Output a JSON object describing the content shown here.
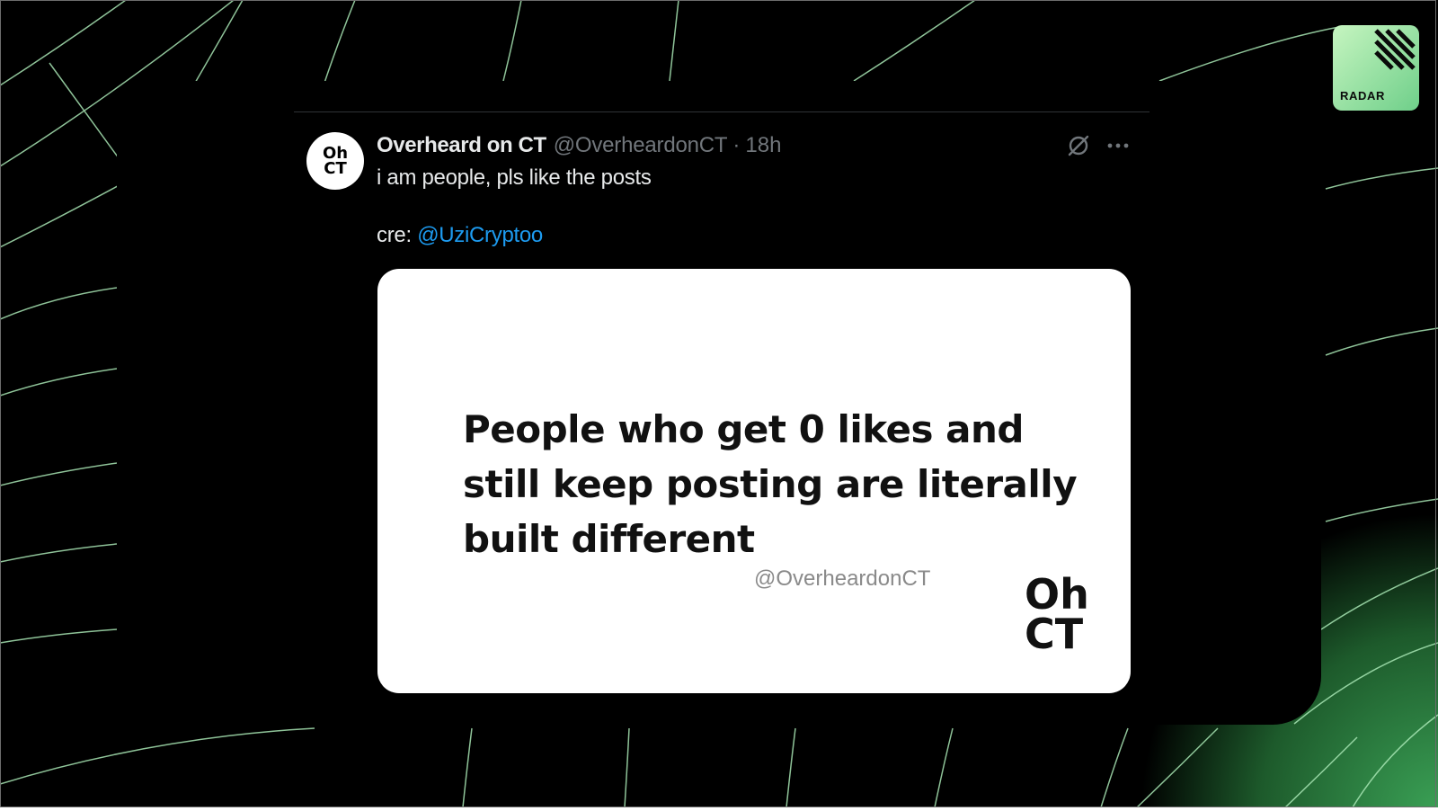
{
  "tweet": {
    "avatar_text": "Oh\nCT",
    "display_name": "Overheard on CT",
    "handle": "@OverheardonCT",
    "separator": "·",
    "time": "18h",
    "text": "i am people, pls like the posts",
    "credit_prefix": "cre:",
    "credit_mention": "@UziCryptoo"
  },
  "card": {
    "text": "People who get 0 likes and still keep posting are literally built different",
    "watermark": "@OverheardonCT",
    "logo_text": "Oh\nCT"
  },
  "badge": {
    "label": "RADAR"
  },
  "icons": [
    "grok-icon",
    "more-icon",
    "radar-stripes-icon"
  ],
  "colors": {
    "accent_link": "#1d9bf0",
    "muted_text": "#71767b",
    "primary_text": "#e7e9ea",
    "bg_green": "#2f8a3e",
    "badge_green": "#8de09a"
  }
}
